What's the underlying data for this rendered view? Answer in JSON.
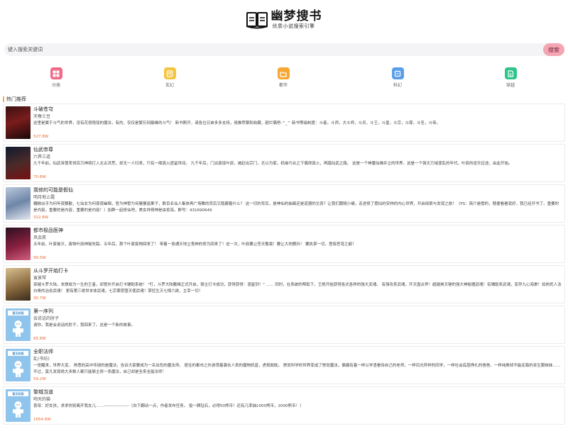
{
  "site": {
    "title": "幽梦搜书",
    "subtitle": "优质小说搜索引擎"
  },
  "search": {
    "placeholder": "键入搜索关键词",
    "button": "搜索"
  },
  "nav": [
    {
      "label": "分类",
      "icon": "grid-icon",
      "color": "#f06b8a"
    },
    {
      "label": "玄幻",
      "icon": "book-icon",
      "color": "#f5c542"
    },
    {
      "label": "都市",
      "icon": "city-icon",
      "color": "#f7a733"
    },
    {
      "label": "科幻",
      "icon": "rocket-icon",
      "color": "#5b9ee8"
    },
    {
      "label": "穿越",
      "icon": "portal-icon",
      "color": "#2ec48a"
    }
  ],
  "section_title": "热门推荐",
  "books": [
    {
      "title": "斗破苍穹",
      "author": "天蚕土豆",
      "desc": "这里是属于斗气的世界，没有花俏艳丽的魔法，有的，仅仅是繁衍到巅峰的斗气！ 新书刚开，请各位兄弟多多支持，用推荐票和收藏，砸烂偶吧-^_^ 新书等级制度：斗者，斗师，大斗师，斗灵，斗王，斗皇，斗宗，斗尊，斗圣，斗帝。",
      "words": "527.8W",
      "cover": "dark-red"
    },
    {
      "title": "仙武帝尊",
      "author": "六界三道",
      "desc": "九千年前，仙武帝尊率领百万神将打入太古洪荒，却无一人归来，只有一缕真火遗留世间。 九千年后，门派废徒叶辰，被赶出宗门，无以为家，机缘巧合之下偶得真火，再踏仙武之路。 这是一个神魔仙佛并立的世界，这是一个强天万域混乱的年代，叶辰的逆天征途，由此开始。",
      "words": "70.8W",
      "cover": "dark-blue"
    },
    {
      "title": "我修的可能是假仙",
      "author": "明月地上霜",
      "desc": "糟糕似乎为何年夜飘散，七仙女为何夜夜幽咽，吾为神誓为何屡屡逼果子，数百名仙人集体再广场舞的背后又隐藏着什么？ 这一切的背后，是神仙的抽离还是道德的沦丧？让我们跟随小编，走进修了假仙的安林的内心世界，开启探索与发现之旅！（PS：简介是假的，随便看看就好，我已经开书了。重要的是内容，重要的是内容，重要的是内容！）加群一起修仙吧，美女帅哥神是由肯亮。群号：431690649",
      "words": "322.8W",
      "cover": "blue-grey"
    },
    {
      "title": "都市极品医神",
      "author": "风会笑",
      "desc": "五年前，叶家被灭，废物叶辰神秘失踪。五年后，那个叶家废物回来了！ 带着一身通天地立鬼神的修为回来了！这一次，叶辰要让苍天敬畏！要让大地颤抖！ 要执掌一切，登临苍穹之巅！",
      "words": "99.5W",
      "cover": "dark-magenta"
    },
    {
      "title": "从斗罗开始打卡",
      "author": "寅景琴",
      "desc": "穿越斗罗大陆，本想成为一生的王者，却意外开启打卡辅助系统！ \"叮，斗罗大陆戴维正式开启，宿主打卡成功，获得获得：混星剑！\" …… 同时，在系统的帮助下，王帆开始获得各式各样的强大武魂。 有强攻系武魂，开天盘古斧！超越昊天锤的强大神秘器武魂！有辅助系武魂，变异九心海棠！如肉死人法白骨的治愈武魂！ 更有第三绝世本体武魂，七宗罪恶堕天使武魂！掌控生灭七情六欲，主宰一切！",
      "words": "30.7W",
      "cover": "tan"
    },
    {
      "title": "第一序列",
      "author": "会说话的肘子",
      "desc": "请你，我是会说话的肘子，我回来了。这是一个新的故事。",
      "words": "65.8W",
      "cover": "default"
    },
    {
      "title": "全职法师",
      "author": "乱(书坊)",
      "desc": "一觉醒来，世界大变。 熟悉的高中传授的是魔法，告诉大家要成为一名出色的魔法师。 居住的都市之外游荡着袭击人类的魔物妖兽，虎视眈眈。 崇尚科学的世界变成了崇尚魔法，偏偏有着一样以学渣看待自己的老师，一样目光异样的同学，一样社会底层挣扎的爸爸，一样纯美却不能走路的亲生跟妹妹…… 不过，莫凡发现绝大多数人都只能够主修一系魔法，自己却是全系全能法师！",
      "words": "59.2W",
      "cover": "default"
    },
    {
      "title": "黎城当道",
      "author": "吻天的猫",
      "desc": "喜母：好女孩，求求你别离开我女儿……------------------（向下翻动一点，作者发布任务。 投一颗钻石，必得50熊币！还有几率抽1000熊币，2000熊币！）",
      "words": "1654.9W",
      "cover": "default"
    }
  ],
  "cover_text": "暂无封面"
}
